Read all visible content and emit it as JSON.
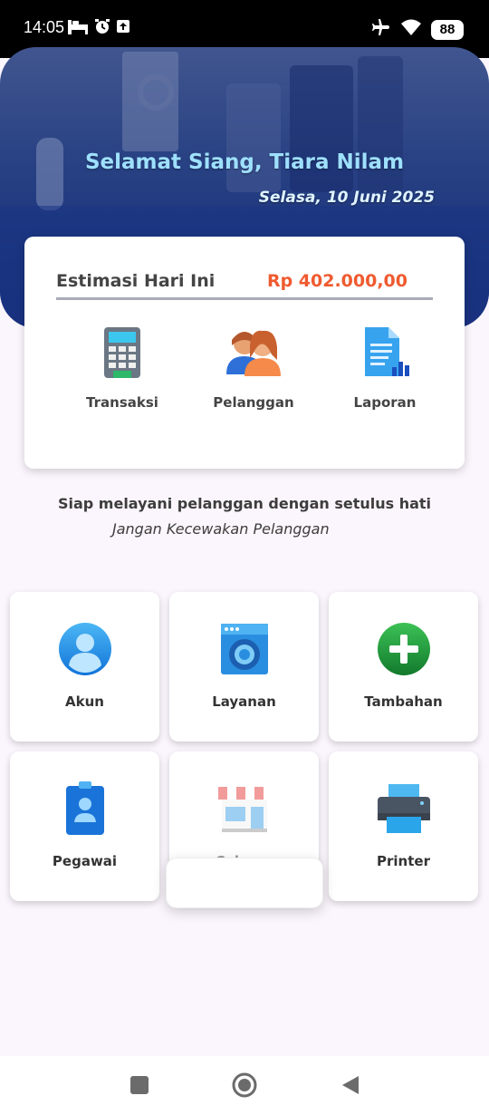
{
  "status_bar": {
    "time": "14:05",
    "battery": "88",
    "icons": [
      "bed-icon",
      "alarm-icon",
      "upload-icon",
      "airplane-icon",
      "wifi-icon",
      "battery-icon"
    ]
  },
  "header": {
    "greeting": "Selamat Siang, Tiara Nilam",
    "date": "Selasa, 10 Juni 2025"
  },
  "summary_card": {
    "estimate_label": "Estimasi Hari Ini",
    "estimate_value": "Rp  402.000,00",
    "actions": [
      {
        "label": "Transaksi",
        "icon": "payment-terminal-icon"
      },
      {
        "label": "Pelanggan",
        "icon": "customers-icon"
      },
      {
        "label": "Laporan",
        "icon": "report-icon"
      }
    ]
  },
  "tagline": {
    "main": "Siap melayani pelanggan dengan setulus hati",
    "sub": "Jangan Kecewakan Pelanggan"
  },
  "menu": [
    {
      "label": "Akun",
      "icon": "account-icon"
    },
    {
      "label": "Layanan",
      "icon": "washing-machine-icon"
    },
    {
      "label": "Tambahan",
      "icon": "add-icon"
    },
    {
      "label": "Pegawai",
      "icon": "employee-badge-icon"
    },
    {
      "label": "Cabang",
      "icon": "store-icon"
    },
    {
      "label": "Printer",
      "icon": "printer-icon"
    }
  ],
  "colors": {
    "accent_orange": "#ef5a2f",
    "greeting_blue": "#9ee0ff",
    "header_blue": "#213c80"
  },
  "nav_bar": {
    "buttons": [
      "recent-apps-button",
      "home-button",
      "back-button"
    ]
  }
}
